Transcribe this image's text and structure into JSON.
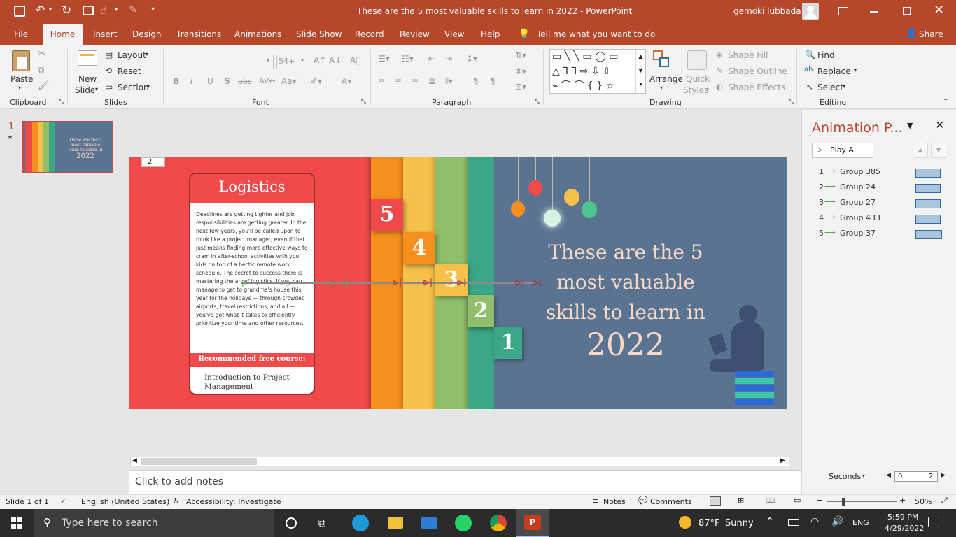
{
  "window": {
    "title": "These are the 5 most valuable skills to learn in 2022  -  PowerPoint",
    "user": "gemoki lubbada"
  },
  "tabs": [
    "File",
    "Home",
    "Insert",
    "Design",
    "Transitions",
    "Animations",
    "Slide Show",
    "Record",
    "Review",
    "View",
    "Help"
  ],
  "tell_me": "Tell me what you want to do",
  "share": "Share",
  "ribbon": {
    "clipboard": {
      "paste": "Paste",
      "label": "Clipboard"
    },
    "slides": {
      "new_slide_1": "New",
      "new_slide_2": "Slide",
      "layout": "Layout",
      "reset": "Reset",
      "section": "Section",
      "label": "Slides"
    },
    "font": {
      "size": "54+",
      "label": "Font"
    },
    "paragraph": {
      "label": "Paragraph"
    },
    "drawing": {
      "arrange": "Arrange",
      "quick_styles_1": "Quick",
      "quick_styles_2": "Styles",
      "shape_fill": "Shape Fill",
      "shape_outline": "Shape Outline",
      "shape_effects": "Shape Effects",
      "label": "Drawing"
    },
    "editing": {
      "find": "Find",
      "replace": "Replace",
      "select": "Select",
      "label": "Editing"
    }
  },
  "thumbnail": {
    "number": "1",
    "star": "★",
    "title_lines": [
      "These are the 5",
      "most valuable",
      "skills to learn in"
    ],
    "year": "2022"
  },
  "slide": {
    "page_box": "2",
    "card_title": "Logistics",
    "card_body": "Deadlines are getting tighter and job responsibilities are getting greater. In the next few years, you'll be called upon to think like a project manager, even if that just means finding more effective ways to cram in after-school activities with your kids on top of a hectic remote work schedule. The secret to success there is mastering the art of logistics. If you can manage to get to grandma's house this year for the holidays — through crowded airports, travel restrictions, and all — you've got what it takes to efficiently prioritize your time and other resources.",
    "card_footer": "Recommended free course:",
    "course": "Introduction to Project Management",
    "tabs": [
      "5",
      "4",
      "3",
      "2",
      "1"
    ],
    "title_lines": [
      "These are the 5",
      "most valuable",
      "skills to learn in"
    ],
    "year": "2022"
  },
  "notes_placeholder": "Click to add notes",
  "anim_pane": {
    "title": "Animation P...",
    "play_all": "Play All",
    "items": [
      {
        "num": "1",
        "name": "Group 385",
        "bar": 0.94
      },
      {
        "num": "2",
        "name": "Group 24",
        "bar": 0.94
      },
      {
        "num": "3",
        "name": "Group 27",
        "bar": 0.94
      },
      {
        "num": "4",
        "name": "Group 433",
        "bar": 0.94
      },
      {
        "num": "5",
        "name": "Group 37",
        "bar": 1.0
      }
    ],
    "seconds": "Seconds",
    "timeline_start": "0",
    "timeline_end": "2"
  },
  "status": {
    "slide": "Slide 1 of 1",
    "language": "English (United States)",
    "accessibility": "Accessibility: Investigate",
    "notes": "Notes",
    "comments": "Comments",
    "zoom": "50%"
  },
  "taskbar": {
    "search": "Type here to search",
    "temp": "87°F",
    "weather": "Sunny",
    "lang": "ENG",
    "time": "5:59 PM",
    "date": "4/29/2022"
  },
  "colors": {
    "accent": "#b7472a",
    "slide_bg": "#5a7391",
    "red": "#f04a4a",
    "orange": "#f5901e",
    "yellow": "#f6c04a",
    "green": "#8fbf6a",
    "teal": "#3aa786"
  }
}
